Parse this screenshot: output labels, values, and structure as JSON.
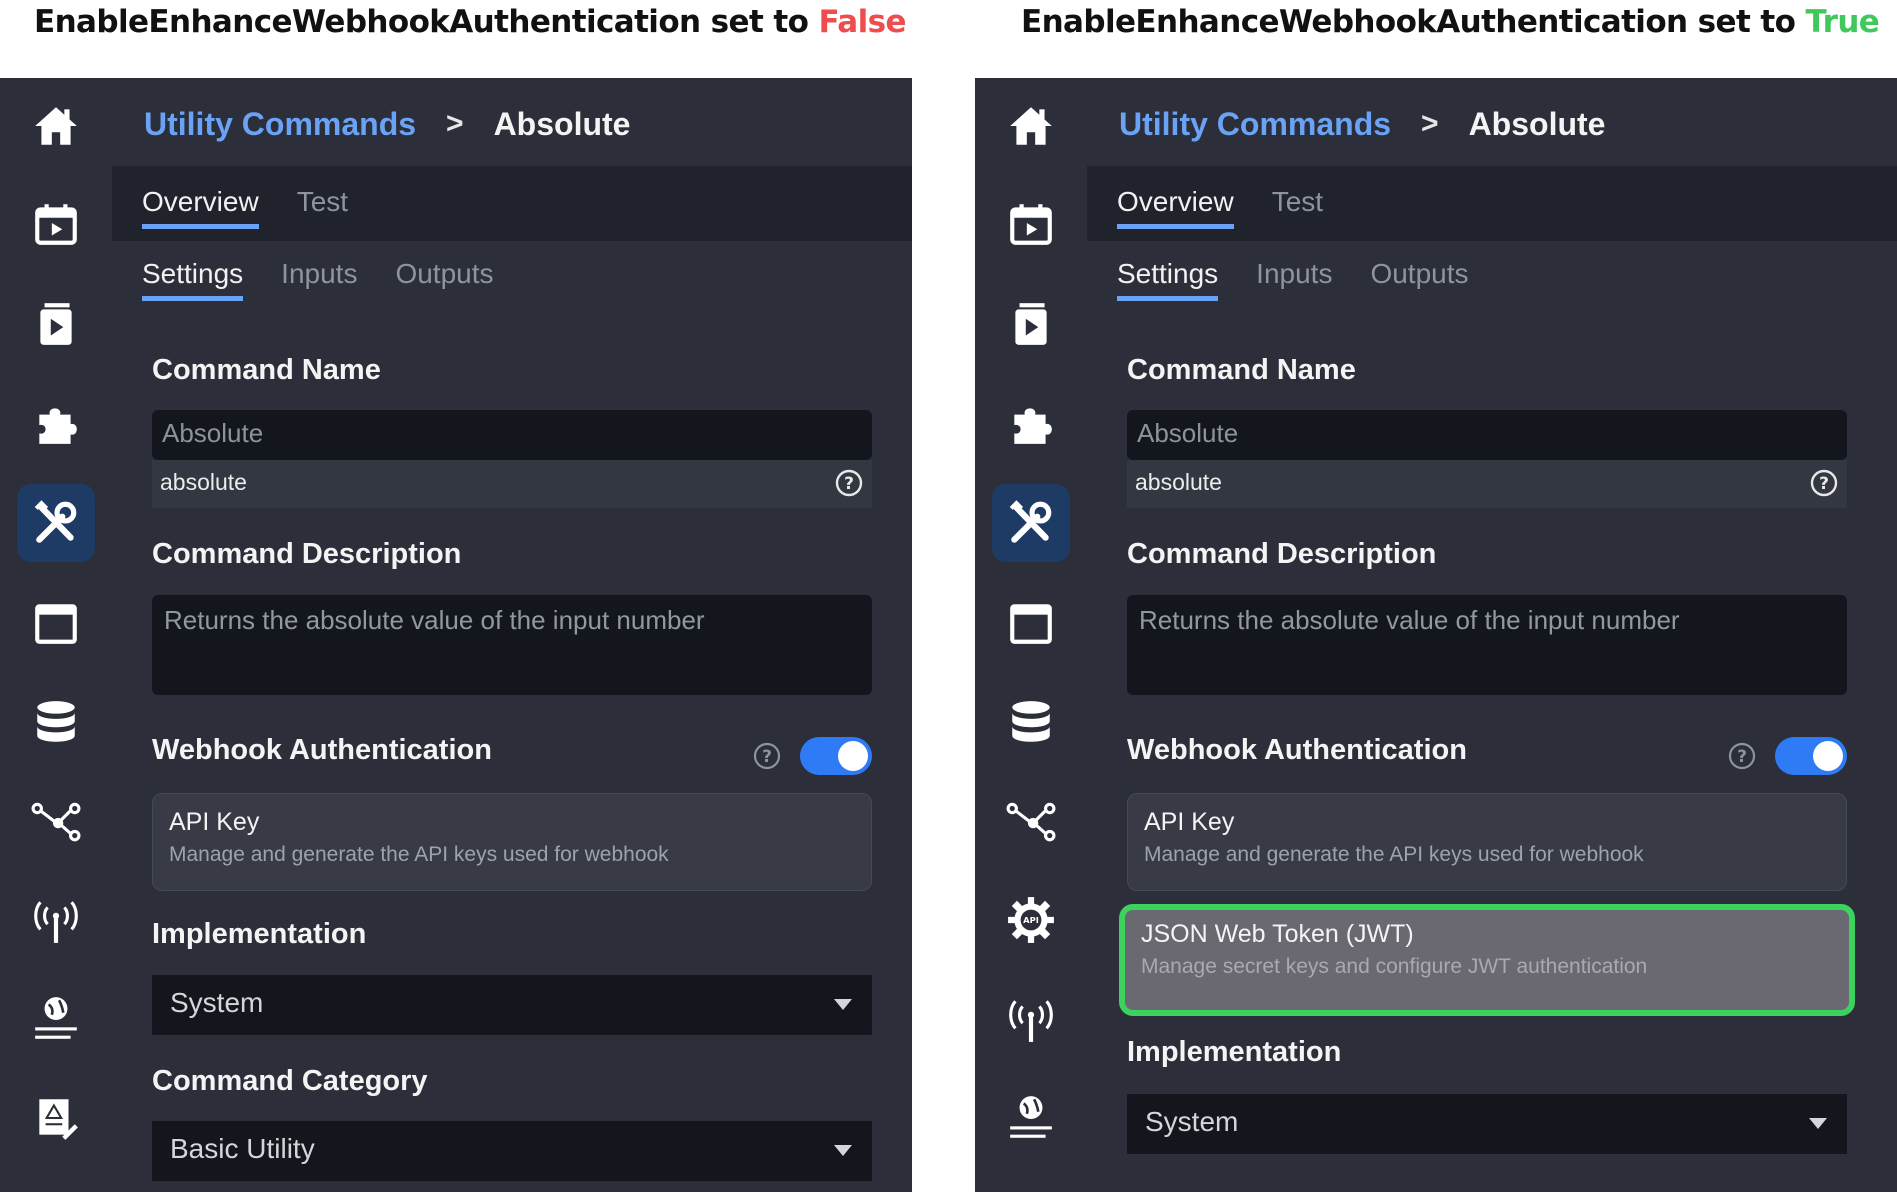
{
  "captions": {
    "left": {
      "prefix": "EnableEnhanceWebhookAuthentication set to ",
      "value": "False",
      "value_color": "#ef4d4d"
    },
    "right": {
      "prefix": "EnableEnhanceWebhookAuthentication set to ",
      "value": "True",
      "value_color": "#3ec95a"
    }
  },
  "breadcrumb": {
    "parent": "Utility Commands",
    "separator": ">",
    "current": "Absolute"
  },
  "tabs": {
    "overview": "Overview",
    "test": "Test"
  },
  "subtabs": {
    "settings": "Settings",
    "inputs": "Inputs",
    "outputs": "Outputs"
  },
  "form": {
    "command_name_label": "Command Name",
    "command_name_value": "Absolute",
    "command_id": "absolute",
    "description_label": "Command Description",
    "description_value": "Returns the absolute value of the input number",
    "webhook_label": "Webhook Authentication",
    "webhook_enabled": true,
    "api_key_title": "API Key",
    "api_key_desc": "Manage and generate the API keys used for webhook",
    "jwt_title": "JSON Web Token (JWT)",
    "jwt_desc": "Manage secret keys and configure JWT authentication",
    "implementation_label": "Implementation",
    "implementation_value": "System",
    "category_label": "Command Category",
    "category_value": "Basic Utility"
  },
  "sidebar": {
    "left_icons": [
      "home-icon",
      "video-calendar-icon",
      "play-document-icon",
      "puzzle-icon",
      "tools-icon",
      "calendar-icon",
      "database-icon",
      "share-nodes-icon",
      "antenna-icon",
      "globe-icon",
      "report-icon"
    ],
    "right_icons": [
      "home-icon",
      "video-calendar-icon",
      "play-document-icon",
      "puzzle-icon",
      "tools-icon",
      "calendar-icon",
      "database-icon",
      "share-nodes-icon",
      "api-gear-icon",
      "antenna-icon",
      "globe-icon"
    ],
    "active": "tools-icon"
  },
  "colors": {
    "accent": "#6aa3f5",
    "toggle_on": "#2f7af5",
    "highlight": "#3bd35e",
    "panel_bg": "#2c2f3a"
  }
}
